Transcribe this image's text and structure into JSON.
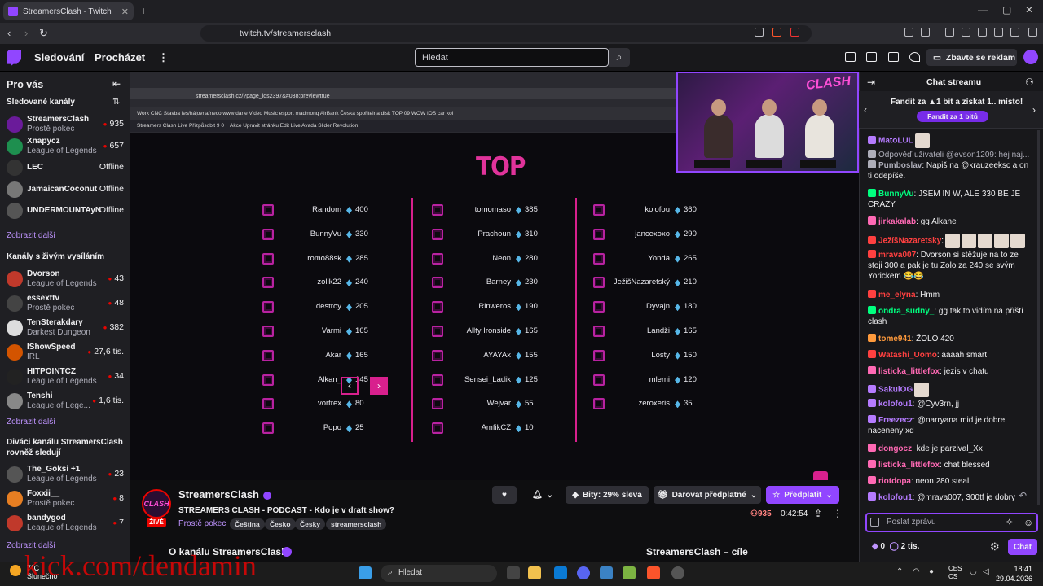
{
  "browser": {
    "tab_title": "StreamersClash - Twitch",
    "new_tab": "+",
    "url": "twitch.tv/streamersclash"
  },
  "nav": {
    "following": "Sledování",
    "browse": "Procházet",
    "search_placeholder": "Hledat",
    "ad_free": "Zbavte se reklam"
  },
  "sidebar": {
    "for_you": "Pro vás",
    "followed_header": "Sledované kanály",
    "followed": [
      {
        "name": "StreamersClash",
        "category": "Prostě pokec",
        "viewers": "935"
      },
      {
        "name": "Xnapycz",
        "category": "League of Legends",
        "viewers": "657"
      },
      {
        "name": "LEC",
        "category": "",
        "viewers": "Offline"
      },
      {
        "name": "JamaicanCoconut",
        "category": "",
        "viewers": "Offline"
      },
      {
        "name": "UNDERMOUNTAyN",
        "category": "",
        "viewers": "Offline"
      }
    ],
    "show_more": "Zobrazit další",
    "live_header": "Kanály s živým vysíláním",
    "live": [
      {
        "name": "Dvorson",
        "category": "League of Legends",
        "viewers": "43"
      },
      {
        "name": "essexttv",
        "category": "Prostě pokec",
        "viewers": "48"
      },
      {
        "name": "TenSterakdary",
        "category": "Darkest Dungeon",
        "viewers": "382"
      },
      {
        "name": "IShowSpeed",
        "category": "IRL",
        "viewers": "27,6 tis."
      },
      {
        "name": "HITPOINTCZ",
        "category": "League of Legends",
        "viewers": "34"
      },
      {
        "name": "Tenshi",
        "category": "League of Lege...",
        "viewers": "1,6 tis."
      }
    ],
    "viewers_header": "Diváci kanálu StreamersClash rovněž sledují",
    "also": [
      {
        "name": "The_Goksi +1",
        "category": "League of Legends",
        "viewers": "23"
      },
      {
        "name": "Foxxii__",
        "category": "Prostě pokec",
        "viewers": "8"
      },
      {
        "name": "bandygod",
        "category": "League of Legends",
        "viewers": "7"
      }
    ]
  },
  "video": {
    "inner_url": "streamersclash.cz/?page_ids2397&#038;previewtrue",
    "inner_bookmarks": "Work   CNC   Stavba   les/hájovna/neco   www   dane   Video   Music   esport   madmonq   AirBank   Česká spořitelna   disk   TOP 09   WOW   IOS   car   koi",
    "inner_toolbar": "Streamers Clash   Live   Přizpůsobit   9   0   + Akce   Upravit stránku   Edit Live   Avada   Slider Revolution",
    "leaderboard_title": "TOP",
    "columns": [
      [
        {
          "name": "Random",
          "score": "400"
        },
        {
          "name": "BunnyVu",
          "score": "330"
        },
        {
          "name": "romo88sk",
          "score": "285"
        },
        {
          "name": "zolik22",
          "score": "240"
        },
        {
          "name": "destroy",
          "score": "205"
        },
        {
          "name": "Varmi",
          "score": "165"
        },
        {
          "name": "Akar",
          "score": "165"
        },
        {
          "name": "Alkan_",
          "score": "145"
        },
        {
          "name": "vortrex",
          "score": "80"
        },
        {
          "name": "Popo",
          "score": "25"
        }
      ],
      [
        {
          "name": "tomomaso",
          "score": "385"
        },
        {
          "name": "Prachoun",
          "score": "310"
        },
        {
          "name": "Neon",
          "score": "280"
        },
        {
          "name": "Barney",
          "score": "230"
        },
        {
          "name": "Rinweros",
          "score": "190"
        },
        {
          "name": "Allty Ironside",
          "score": "165"
        },
        {
          "name": "AYAYAx",
          "score": "155"
        },
        {
          "name": "Sensei_Ladik",
          "score": "125"
        },
        {
          "name": "Wejvar",
          "score": "55"
        },
        {
          "name": "AmfikCZ",
          "score": "10"
        }
      ],
      [
        {
          "name": "kolofou",
          "score": "360"
        },
        {
          "name": "jancexoxo",
          "score": "290"
        },
        {
          "name": "Yonda",
          "score": "265"
        },
        {
          "name": "JežišNazaretský",
          "score": "210"
        },
        {
          "name": "Dyvajn",
          "score": "180"
        },
        {
          "name": "Landži",
          "score": "165"
        },
        {
          "name": "Losty",
          "score": "150"
        },
        {
          "name": "mlemi",
          "score": "120"
        },
        {
          "name": "zeroxeris",
          "score": "35"
        }
      ]
    ],
    "cam_logo": "CLASH"
  },
  "stream": {
    "channel": "StreamersClash",
    "live": "ŽIVĚ",
    "title": "STREAMERS CLASH - PODCAST - Kdo je v draft show?",
    "category": "Prostě pokec",
    "tags": [
      "Čeština",
      "Česko",
      "Česky",
      "streamersclash"
    ],
    "bits": "Bity: 29% sleva",
    "gift": "Darovat předplatné",
    "subscribe": "Předplatit",
    "viewers": "935",
    "uptime": "0:42:54",
    "about": "O kanálu StreamersClash",
    "goals": "StreamersClash – cíle"
  },
  "chat": {
    "header": "Chat streamu",
    "banner": "Fandit za ▲1 bit a získat 1.. místo!",
    "banner_btn": "Fandit za 1 bitů",
    "messages": [
      {
        "user": "MatoLUL",
        "text": "",
        "color": "#b57bff"
      },
      {
        "user": "",
        "text": "Odpověď uživateli @evson1209: hej naj...",
        "color": "#adadb8"
      },
      {
        "user": "Pumboslav",
        "text": ": Napiš na @krauzeeksc a on ti odepíše.",
        "color": "#adadb8"
      },
      {
        "user": "BunnyVu",
        "text": ": JSEM IN W, ALE 330 BE JE CRAZY",
        "color": "#00ff7f"
      },
      {
        "user": "jirkakalab",
        "text": ": gg Alkane",
        "color": "#ff69b4"
      },
      {
        "user": "JežíšNazaretsky",
        "text": ":",
        "color": "#ff4040"
      },
      {
        "user": "mrava007",
        "text": ": Dvorson si stěžuje na to ze stoji 300 a pak je tu Zolo za 240 se svým Yorickem 😂😂",
        "color": "#ff4040"
      },
      {
        "user": "me_elyna",
        "text": ": Hmm",
        "color": "#ff4040"
      },
      {
        "user": "ondra_sudny_",
        "text": ": gg tak to vidím na příští clash",
        "color": "#00ff7f"
      },
      {
        "user": "tome941",
        "text": ": ŽOLO 420",
        "color": "#ff9a3c"
      },
      {
        "user": "Watashi_Uomo",
        "text": ": aaaah smart",
        "color": "#ff4040"
      },
      {
        "user": "listicka_littlefox",
        "text": ": jezis v chatu",
        "color": "#ff69b4"
      },
      {
        "user": "SakulOG",
        "text": "",
        "color": "#b57bff"
      },
      {
        "user": "kolofou1",
        "text": ": @Cyv3rn, jj",
        "color": "#b57bff"
      },
      {
        "user": "Freezecz",
        "text": ": @narryana mid je dobre naceneny xd",
        "color": "#b57bff"
      },
      {
        "user": "dongocz",
        "text": ": kde je parzival_Xx",
        "color": "#ff69b4"
      },
      {
        "user": "listicka_littlefox",
        "text": ": chat blessed",
        "color": "#ff69b4"
      },
      {
        "user": "riotdopa",
        "text": ": neon 280 steal",
        "color": "#ff69b4"
      },
      {
        "user": "kolofou1",
        "text": ": @mrava007, 300tf je dobry",
        "color": "#b57bff"
      }
    ],
    "input_placeholder": "Poslat zprávu",
    "points": "0",
    "bits_count": "2 tis.",
    "send": "Chat"
  },
  "taskbar": {
    "temp": "7°C",
    "weather": "Slunečno",
    "search": "Hledat",
    "lang1": "CES",
    "lang2": "CS",
    "time": "18:41",
    "date": "29.04.2026"
  },
  "watermark": "kick.com/dendamin"
}
